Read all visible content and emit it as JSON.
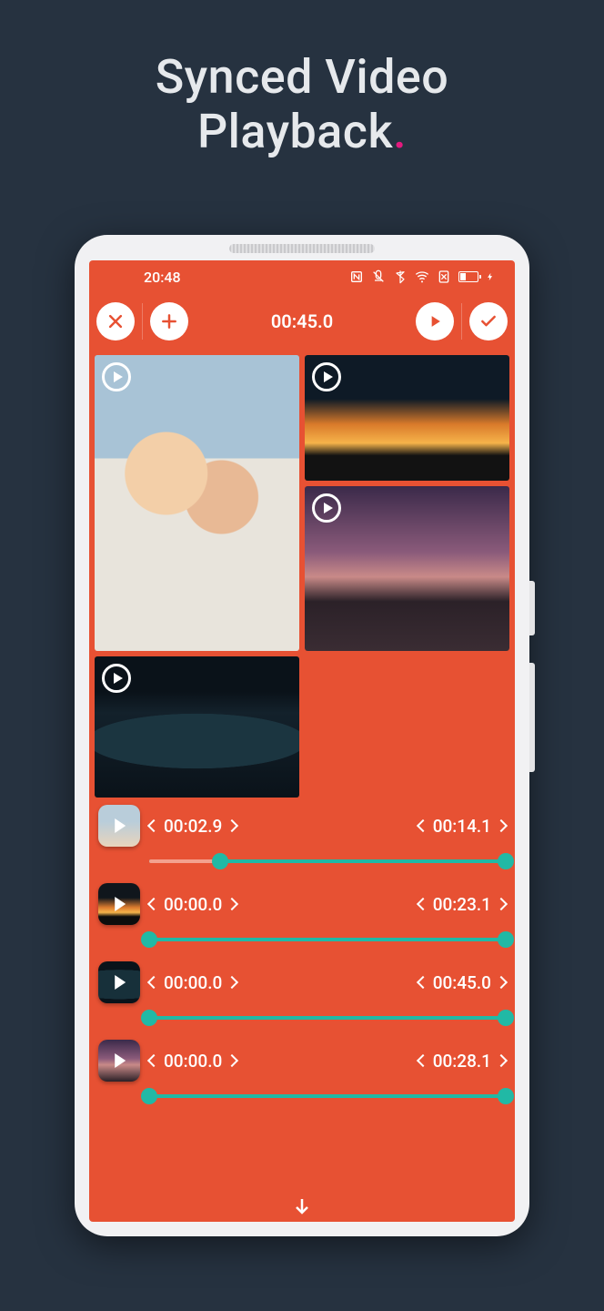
{
  "headline": {
    "line1": "Synced Video",
    "line2": "Playback",
    "dot": "."
  },
  "status": {
    "time": "20:48"
  },
  "toolbar": {
    "time": "00:45.0"
  },
  "tracks": [
    {
      "start": "00:02.9",
      "end": "00:14.1",
      "progress_pct": 20
    },
    {
      "start": "00:00.0",
      "end": "00:23.1",
      "progress_pct": 0
    },
    {
      "start": "00:00.0",
      "end": "00:45.0",
      "progress_pct": 0
    },
    {
      "start": "00:00.0",
      "end": "00:28.1",
      "progress_pct": 0
    }
  ]
}
